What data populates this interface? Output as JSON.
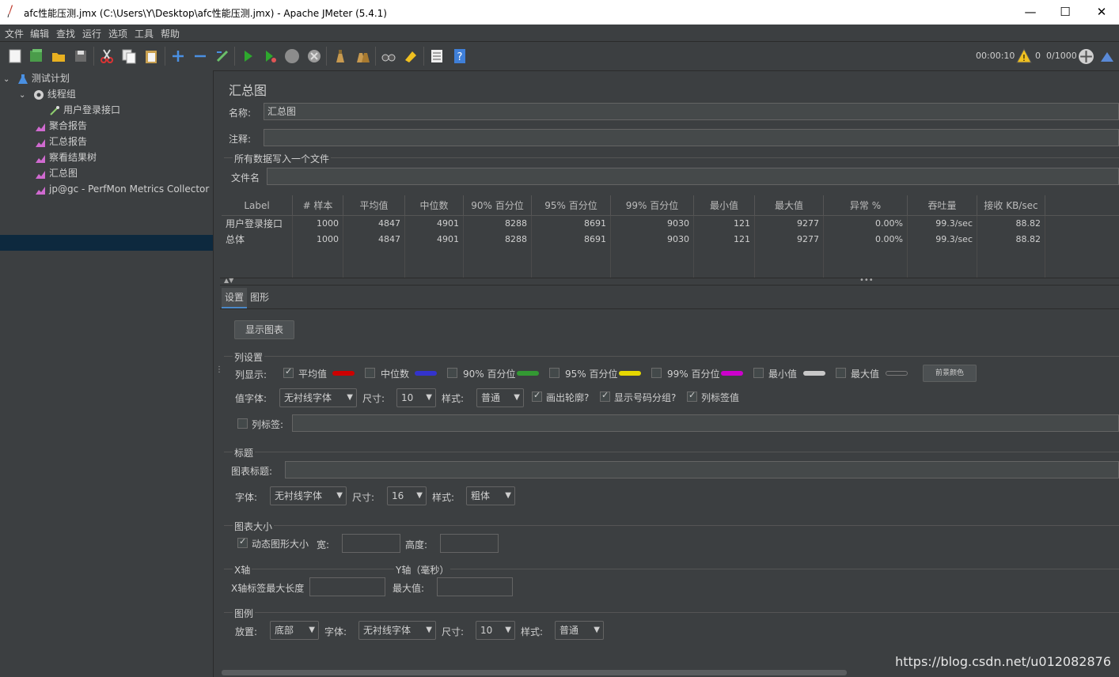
{
  "window": {
    "title": "afc性能压测.jmx (C:\\Users\\Y\\Desktop\\afc性能压测.jmx) - Apache JMeter (5.4.1)",
    "minimize": "—",
    "maximize": "☐",
    "close": "✕"
  },
  "menu": [
    "文件",
    "编辑",
    "查找",
    "运行",
    "选项",
    "工具",
    "帮助"
  ],
  "status": {
    "elapsed": "00:00:10",
    "warnings": "0",
    "threads": "0/1000"
  },
  "tree": {
    "items": [
      {
        "label": "测试计划"
      },
      {
        "label": "线程组"
      },
      {
        "label": "用户登录接口"
      },
      {
        "label": "聚合报告"
      },
      {
        "label": "汇总报告"
      },
      {
        "label": "察看结果树"
      },
      {
        "label": "汇总图"
      },
      {
        "label": "jp@gc - PerfMon Metrics Collector"
      }
    ]
  },
  "panel": {
    "title": "汇总图",
    "name_label": "名称:",
    "name_value": "汇总图",
    "comment_label": "注释:",
    "file_group": "所有数据写入一个文件",
    "filename_label": "文件名"
  },
  "table": {
    "headers": [
      "Label",
      "# 样本",
      "平均值",
      "中位数",
      "90% 百分位",
      "95% 百分位",
      "99% 百分位",
      "最小值",
      "最大值",
      "异常 %",
      "吞吐量",
      "接收 KB/sec"
    ],
    "rows": [
      [
        "用户登录接口",
        "1000",
        "4847",
        "4901",
        "8288",
        "8691",
        "9030",
        "121",
        "9277",
        "0.00%",
        "99.3/sec",
        "88.82"
      ],
      [
        "总体",
        "1000",
        "4847",
        "4901",
        "8288",
        "8691",
        "9030",
        "121",
        "9277",
        "0.00%",
        "99.3/sec",
        "88.82"
      ]
    ]
  },
  "tabs": {
    "settings": "设置",
    "graph": "图形"
  },
  "settings": {
    "show_graph_button": "显示图表",
    "col_settings_group": "列设置",
    "col_display_label": "列显示:",
    "columns": [
      {
        "label": "平均值",
        "checked": true,
        "color": "#cc0000"
      },
      {
        "label": "中位数",
        "checked": false,
        "color": "#3333cc"
      },
      {
        "label": "90% 百分位",
        "checked": false,
        "color": "#339933"
      },
      {
        "label": "95% 百分位",
        "checked": false,
        "color": "#e6d800"
      },
      {
        "label": "99% 百分位",
        "checked": false,
        "color": "#cc00cc"
      },
      {
        "label": "最小值",
        "checked": false,
        "color": "#c8c8c8"
      },
      {
        "label": "最大值",
        "checked": false,
        "color": "#3c3f41"
      }
    ],
    "fg_color_button": "前景颜色",
    "value_font_label": "值字体:",
    "value_font": "无衬线字体",
    "size_label": "尺寸:",
    "value_size": "10",
    "style_label": "样式:",
    "value_style": "普通",
    "draw_outline": "画出轮廓?",
    "show_number_group": "显示号码分组?",
    "col_label_value": "列标签值",
    "col_label": "列标签:",
    "title_group": "标题",
    "chart_title_label": "图表标题:",
    "font_label": "字体:",
    "title_font": "无衬线字体",
    "title_size": "16",
    "title_style": "粗体",
    "chart_size_group": "图表大小",
    "dynamic_size": "动态图形大小",
    "width_label": "宽:",
    "height_label": "高度:",
    "x_axis_group": "X轴",
    "y_axis_group": "Y轴（毫秒）",
    "x_label_maxlen": "X轴标签最大长度",
    "y_max_label": "最大值:",
    "legend_group": "图例",
    "placement_label": "放置:",
    "legend_placement": "底部",
    "legend_font": "无衬线字体",
    "legend_size": "10",
    "legend_style": "普通"
  },
  "watermark": "https://blog.csdn.net/u012082876"
}
